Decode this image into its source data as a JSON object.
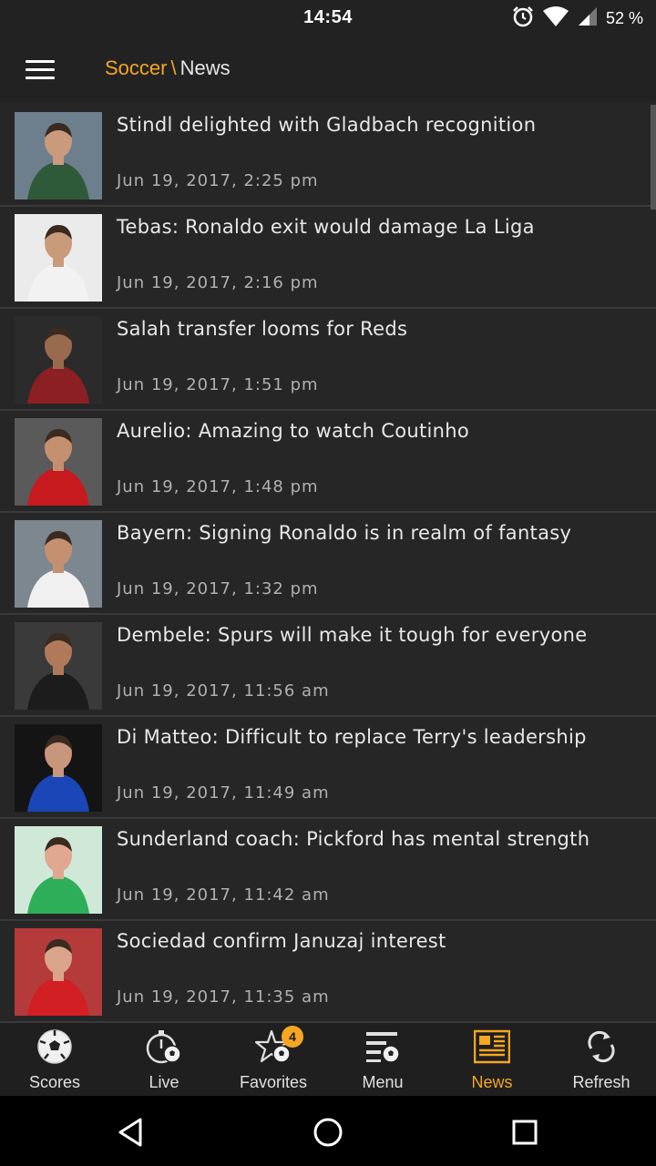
{
  "status_bar": {
    "time": "14:54",
    "battery": "52 %",
    "icons": [
      "alarm-icon",
      "wifi-icon",
      "signal-icon"
    ]
  },
  "app_bar": {
    "menu_icon": "hamburger-icon",
    "sport": "Soccer",
    "separator": "\\",
    "section": "News"
  },
  "news": [
    {
      "headline": "Stindl delighted with Gladbach recognition",
      "date": "Jun 19, 2017, 2:25 pm",
      "thumb": {
        "bg": "#6d7f8c",
        "kit": "#2f5a3a",
        "skin": "#c99a7c"
      }
    },
    {
      "headline": "Tebas: Ronaldo exit would damage La Liga",
      "date": "Jun 19, 2017, 2:16 pm",
      "thumb": {
        "bg": "#ebebeb",
        "kit": "#f2f2f2",
        "skin": "#c89b7b"
      }
    },
    {
      "headline": "Salah transfer looms for Reds",
      "date": "Jun 19, 2017, 1:51 pm",
      "thumb": {
        "bg": "#2b2b2b",
        "kit": "#8b1f24",
        "skin": "#9a6a4e"
      }
    },
    {
      "headline": "Aurelio: Amazing to watch Coutinho",
      "date": "Jun 19, 2017, 1:48 pm",
      "thumb": {
        "bg": "#5a5a5a",
        "kit": "#c61a1f",
        "skin": "#c49070"
      }
    },
    {
      "headline": "Bayern: Signing Ronaldo is in realm of fantasy",
      "date": "Jun 19, 2017, 1:32 pm",
      "thumb": {
        "bg": "#7d8790",
        "kit": "#f0f0f0",
        "skin": "#c49070"
      }
    },
    {
      "headline": "Dembele: Spurs will make it tough for everyone",
      "date": "Jun 19, 2017, 11:56 am",
      "thumb": {
        "bg": "#3a3a3a",
        "kit": "#1c1c1c",
        "skin": "#b07a5a"
      }
    },
    {
      "headline": "Di Matteo: Difficult to replace Terry's leadership",
      "date": "Jun 19, 2017, 11:49 am",
      "thumb": {
        "bg": "#141414",
        "kit": "#1a46b8",
        "skin": "#c8967a"
      }
    },
    {
      "headline": "Sunderland coach: Pickford has mental strength",
      "date": "Jun 19, 2017, 11:42 am",
      "thumb": {
        "bg": "#cfe8d8",
        "kit": "#2fae5a",
        "skin": "#e0a890"
      }
    },
    {
      "headline": "Sociedad confirm Januzaj interest",
      "date": "Jun 19, 2017, 11:35 am",
      "thumb": {
        "bg": "#b53a3a",
        "kit": "#d11f24",
        "skin": "#d9a48a"
      }
    }
  ],
  "bottom_nav": [
    {
      "label": "Scores",
      "icon": "soccer-ball-icon",
      "active": false
    },
    {
      "label": "Live",
      "icon": "stopwatch-ball-icon",
      "active": false
    },
    {
      "label": "Favorites",
      "icon": "star-ball-icon",
      "active": false,
      "badge": "4"
    },
    {
      "label": "Menu",
      "icon": "list-ball-icon",
      "active": false
    },
    {
      "label": "News",
      "icon": "newspaper-icon",
      "active": true
    },
    {
      "label": "Refresh",
      "icon": "refresh-icon",
      "active": false
    }
  ],
  "colors": {
    "accent": "#f5a623",
    "background": "#262626",
    "appbar": "#222222",
    "divider": "#3a3a3a",
    "text": "#e8e8e8",
    "muted_text": "#b0b0b0"
  },
  "system_nav": [
    "back-icon",
    "home-icon",
    "recents-icon"
  ]
}
